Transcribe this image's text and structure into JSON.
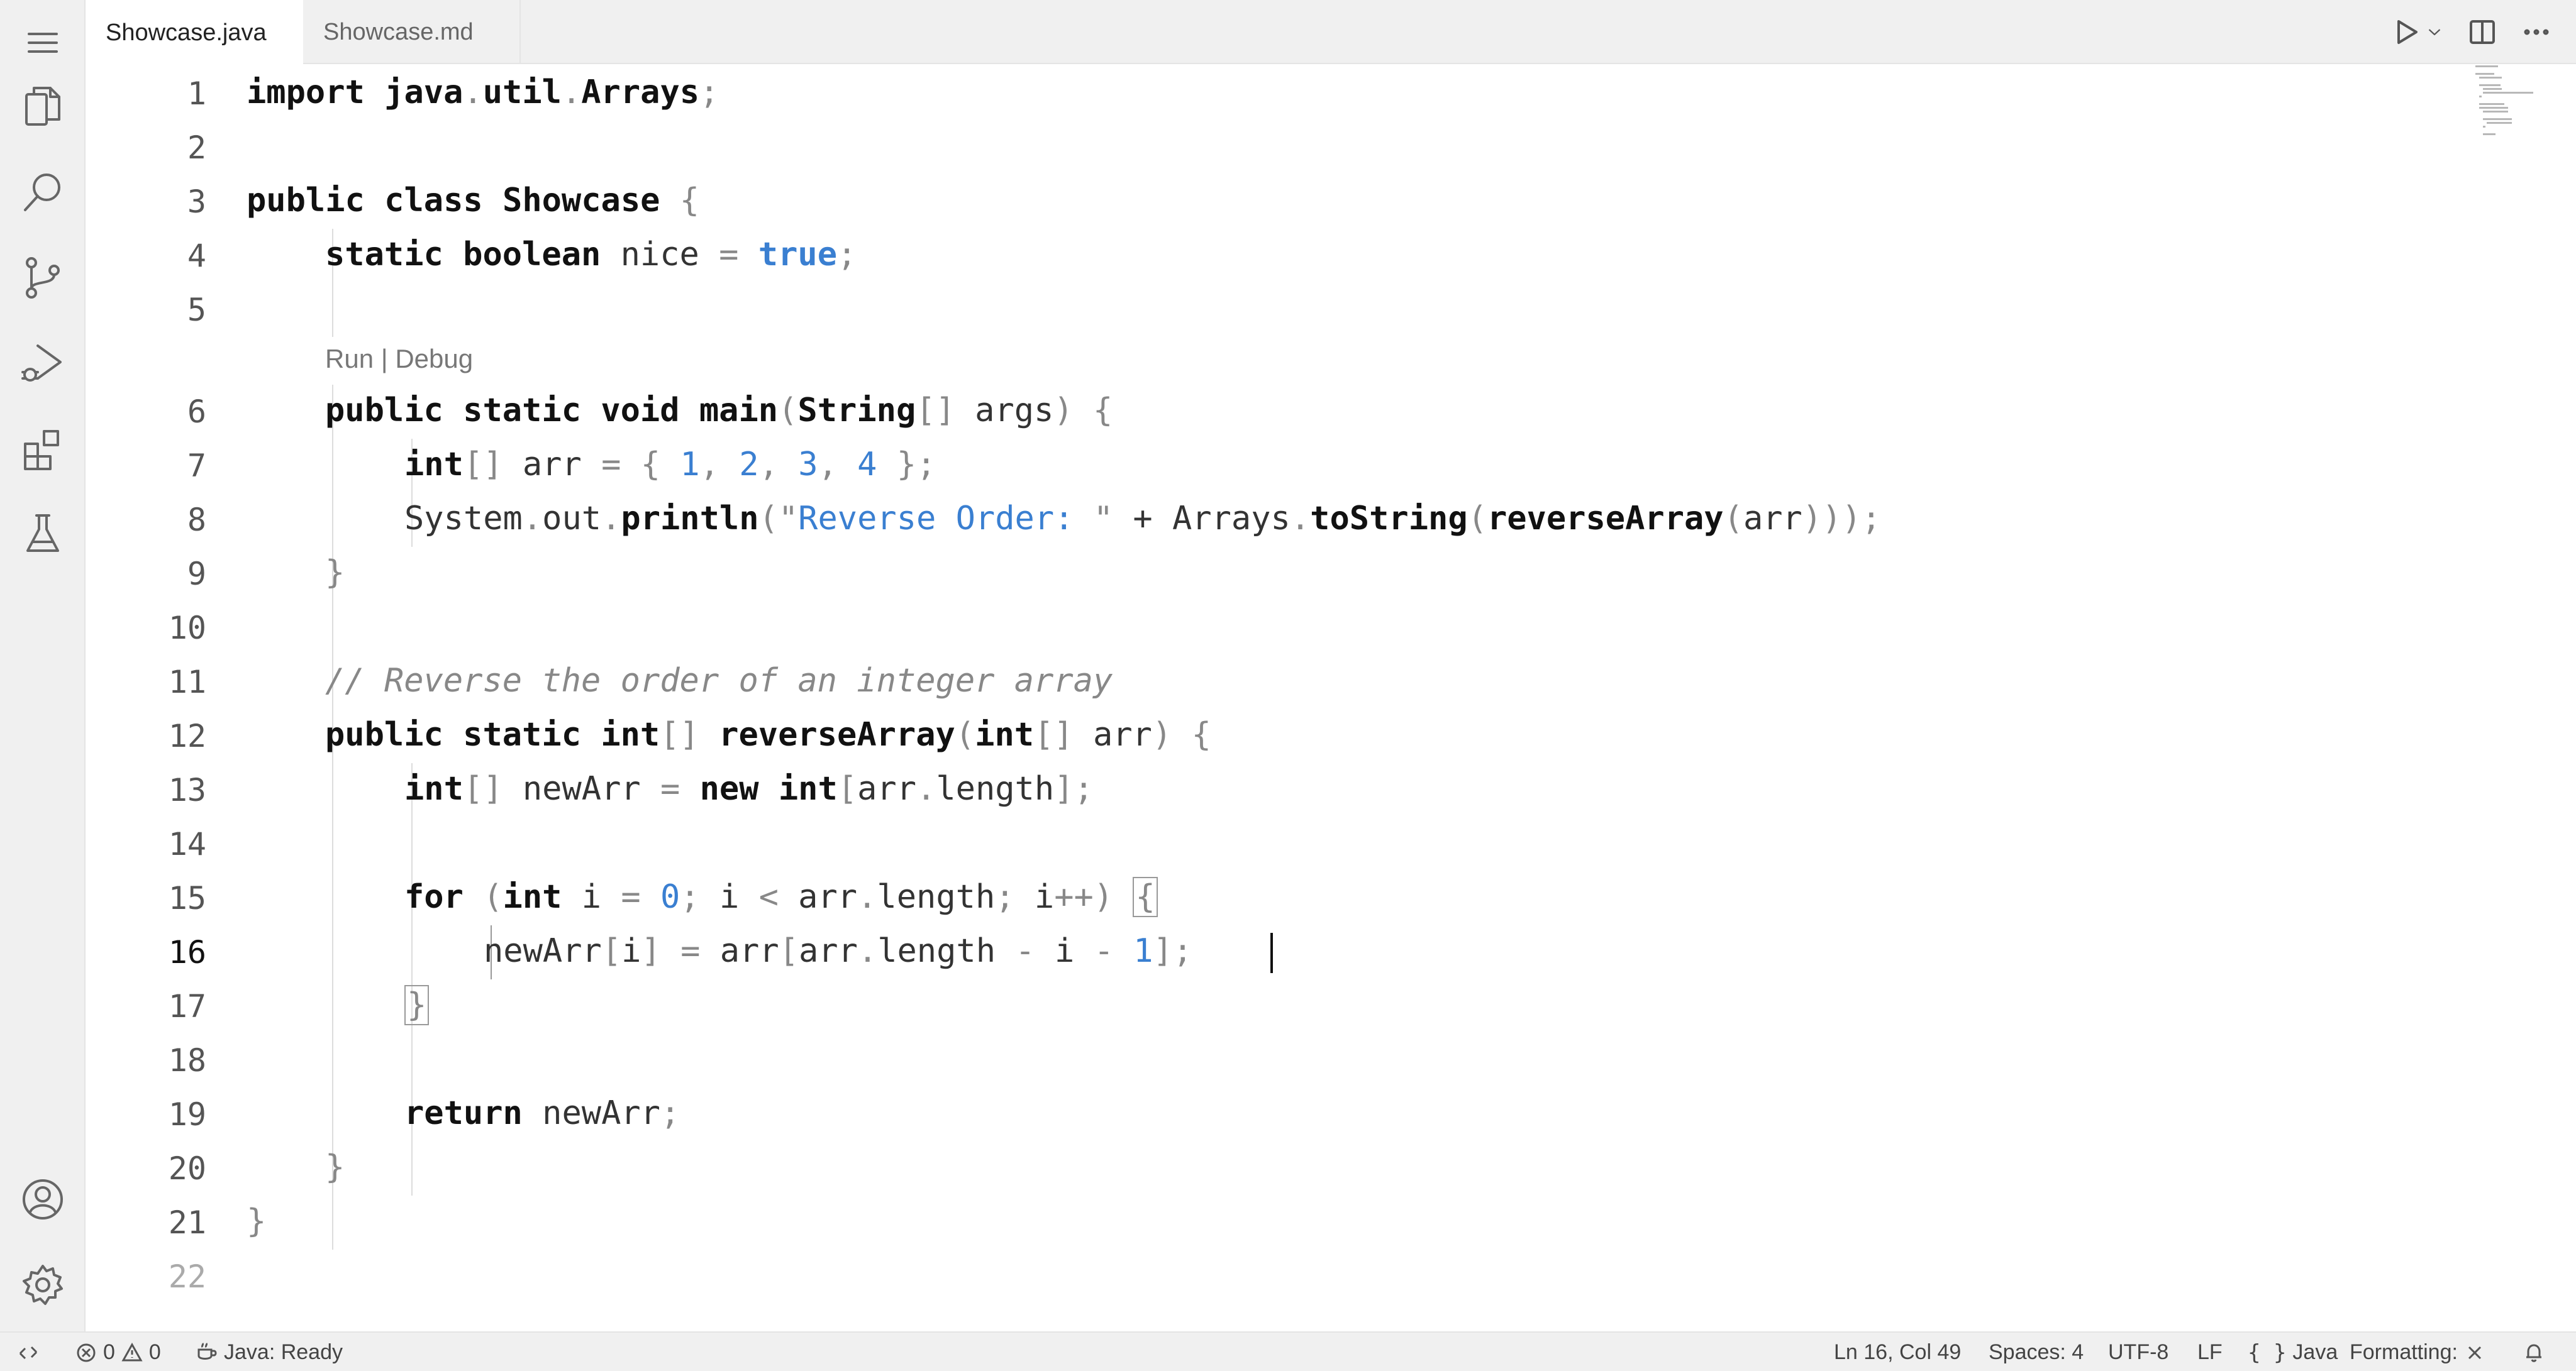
{
  "tabs": [
    {
      "label": "Showcase.java",
      "active": true
    },
    {
      "label": "Showcase.md",
      "active": false
    }
  ],
  "activity_bar": {
    "items": [
      {
        "name": "menu-icon"
      },
      {
        "name": "explorer-icon"
      },
      {
        "name": "search-icon"
      },
      {
        "name": "source-control-icon"
      },
      {
        "name": "run-debug-icon"
      },
      {
        "name": "extensions-icon"
      },
      {
        "name": "testing-icon"
      },
      {
        "name": "account-icon"
      },
      {
        "name": "settings-gear-icon"
      }
    ]
  },
  "editor": {
    "line_numbers": [
      "1",
      "2",
      "3",
      "4",
      "5",
      "6",
      "7",
      "8",
      "9",
      "10",
      "11",
      "12",
      "13",
      "14",
      "15",
      "16",
      "17",
      "18",
      "19",
      "20",
      "21",
      "22"
    ],
    "current_line": "16",
    "codelens": {
      "run": "Run",
      "sep": " | ",
      "debug": "Debug"
    },
    "code": {
      "l1": {
        "t1": "import",
        "t2": " ",
        "t3": "java",
        "t4": ".",
        "t5": "util",
        "t6": ".",
        "t7": "Arrays",
        "t8": ";"
      },
      "l3": {
        "t1": "public",
        "t2": " ",
        "t3": "class",
        "t4": " ",
        "t5": "Showcase",
        "t6": " ",
        "t7": "{"
      },
      "l4": {
        "t1": "static",
        "t2": " ",
        "t3": "boolean",
        "t4": " nice ",
        "t5": "=",
        "t6": " ",
        "t7": "true",
        "t8": ";"
      },
      "l6": {
        "t1": "public",
        "t2": " ",
        "t3": "static",
        "t4": " ",
        "t5": "void",
        "t6": " ",
        "t7": "main",
        "t8": "(",
        "t9": "String",
        "t10": "[]",
        "t11": " args",
        "t12": ")",
        "t13": " ",
        "t14": "{"
      },
      "l7": {
        "t1": "int",
        "t2": "[]",
        "t3": " arr ",
        "t4": "=",
        "t5": " ",
        "t6": "{",
        "t7": " ",
        "t8": "1",
        "t9": ",",
        "t10": " ",
        "t11": "2",
        "t12": ",",
        "t13": " ",
        "t14": "3",
        "t15": ",",
        "t16": " ",
        "t17": "4",
        "t18": " ",
        "t19": "}",
        "t20": ";"
      },
      "l8": {
        "t1": "System",
        "t2": ".",
        "t3": "out",
        "t4": ".",
        "t5": "println",
        "t6": "(",
        "t7": "\"",
        "t8": "Reverse Order: ",
        "t9": "\"",
        "t10": " + Arrays",
        "t11": ".",
        "t12": "toString",
        "t13": "(",
        "t14": "reverseArray",
        "t15": "(",
        "t16": "arr",
        "t17": ")))",
        "t18": ";"
      },
      "l9": {
        "t1": "}"
      },
      "l11": {
        "t1": "// Reverse the order of an integer array"
      },
      "l12": {
        "t1": "public",
        "t2": " ",
        "t3": "static",
        "t4": " ",
        "t5": "int",
        "t6": "[]",
        "t7": " ",
        "t8": "reverseArray",
        "t9": "(",
        "t10": "int",
        "t11": "[]",
        "t12": " arr",
        "t13": ")",
        "t14": " ",
        "t15": "{"
      },
      "l13": {
        "t1": "int",
        "t2": "[]",
        "t3": " newArr ",
        "t4": "=",
        "t5": " ",
        "t6": "new",
        "t7": " ",
        "t8": "int",
        "t9": "[",
        "t10": "arr",
        "t11": ".",
        "t12": "length",
        "t13": "]",
        "t14": ";"
      },
      "l15": {
        "t1": "for",
        "t2": " ",
        "t3": "(",
        "t4": "int",
        "t5": " i ",
        "t6": "=",
        "t7": " ",
        "t8": "0",
        "t9": ";",
        "t10": " i ",
        "t11": "<",
        "t12": " arr",
        "t13": ".",
        "t14": "length",
        "t15": ";",
        "t16": " i",
        "t17": "++",
        "t18": ")",
        "t19": " ",
        "t20": "{"
      },
      "l16": {
        "t1": "newArr",
        "t2": "[",
        "t3": "i",
        "t4": "]",
        "t5": " ",
        "t6": "=",
        "t7": " arr",
        "t8": "[",
        "t9": "arr",
        "t10": ".",
        "t11": "length",
        "t12": " ",
        "t13": "-",
        "t14": " i ",
        "t15": "-",
        "t16": " ",
        "t17": "1",
        "t18": "]",
        "t19": ";"
      },
      "l17": {
        "t1": "}"
      },
      "l19": {
        "t1": "return",
        "t2": " newArr",
        "t3": ";"
      },
      "l20": {
        "t1": "}"
      },
      "l21": {
        "t1": "}"
      }
    }
  },
  "status_bar": {
    "errors": "0",
    "warnings": "0",
    "java_status": "Java: Ready",
    "cursor_position": "Ln 16, Col 49",
    "indentation": "Spaces: 4",
    "encoding": "UTF-8",
    "eol": "LF",
    "language": "Java",
    "formatting": "Formatting:"
  },
  "colors": {
    "keyword": "#111111",
    "literal": "#3a7fd1",
    "comment": "#888888",
    "chrome_bg": "#f0f0f0"
  }
}
